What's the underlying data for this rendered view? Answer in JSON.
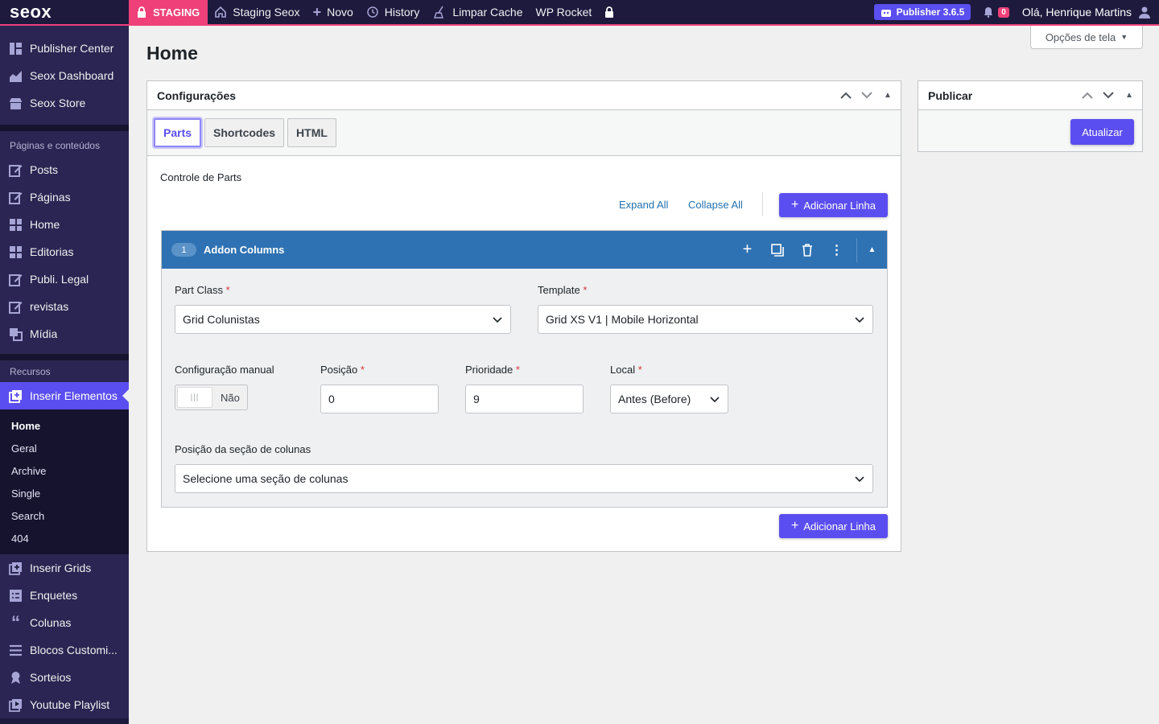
{
  "adminbar": {
    "logo": "seox",
    "staging": "STAGING",
    "site": "Staging Seox",
    "new": "Novo",
    "history": "History",
    "clear_cache": "Limpar Cache",
    "wp_rocket": "WP Rocket",
    "publisher": "Publisher 3.6.5",
    "notifications": "0",
    "greeting": "Olá, Henrique Martins"
  },
  "sidebar": {
    "top": [
      {
        "label": "Publisher Center",
        "icon": "grid-icon"
      },
      {
        "label": "Seox Dashboard",
        "icon": "chart-icon"
      },
      {
        "label": "Seox Store",
        "icon": "store-icon"
      }
    ],
    "heading_content": "Páginas e conteúdos",
    "content": [
      {
        "label": "Posts",
        "icon": "edit-icon"
      },
      {
        "label": "Páginas",
        "icon": "edit-icon"
      },
      {
        "label": "Home",
        "icon": "blocks-icon"
      },
      {
        "label": "Editorias",
        "icon": "blocks-icon"
      },
      {
        "label": "Publi. Legal",
        "icon": "edit-icon"
      },
      {
        "label": "revistas",
        "icon": "edit-icon"
      },
      {
        "label": "Mídia",
        "icon": "media-icon"
      }
    ],
    "heading_resources": "Recursos",
    "active": "Inserir Elementos",
    "submenu": [
      "Home",
      "Geral",
      "Archive",
      "Single",
      "Search",
      "404"
    ],
    "bottom": [
      {
        "label": "Inserir Grids",
        "icon": "plus-square-icon"
      },
      {
        "label": "Enquetes",
        "icon": "poll-icon"
      },
      {
        "label": "Colunas",
        "icon": "quote-icon"
      },
      {
        "label": "Blocos Customi...",
        "icon": "list-icon"
      },
      {
        "label": "Sorteios",
        "icon": "award-icon"
      },
      {
        "label": "Youtube Playlist",
        "icon": "playlist-icon"
      }
    ]
  },
  "screen_options": "Opções de tela",
  "page_title": "Home",
  "config": {
    "title": "Configurações",
    "tabs": [
      "Parts",
      "Shortcodes",
      "HTML"
    ],
    "section_label": "Controle de Parts",
    "expand_all": "Expand All",
    "collapse_all": "Collapse All",
    "add_line": "Adicionar Linha",
    "part": {
      "number": "1",
      "title": "Addon Columns",
      "part_class_label": "Part Class",
      "part_class_value": "Grid Colunistas",
      "template_label": "Template",
      "template_value": "Grid XS V1 | Mobile Horizontal",
      "manual_label": "Configuração manual",
      "manual_value": "Não",
      "position_label": "Posição",
      "position_value": "0",
      "priority_label": "Prioridade",
      "priority_value": "9",
      "local_label": "Local",
      "local_value": "Antes (Before)",
      "section_pos_label": "Posição da seção de colunas",
      "section_pos_value": "Selecione uma seção de colunas"
    }
  },
  "publish": {
    "title": "Publicar",
    "update": "Atualizar"
  },
  "colors": {
    "accent": "#5b4ef0",
    "sidebar_bg": "#1d1a3d",
    "staging": "#f0407a",
    "part_header": "#2f72b3"
  }
}
